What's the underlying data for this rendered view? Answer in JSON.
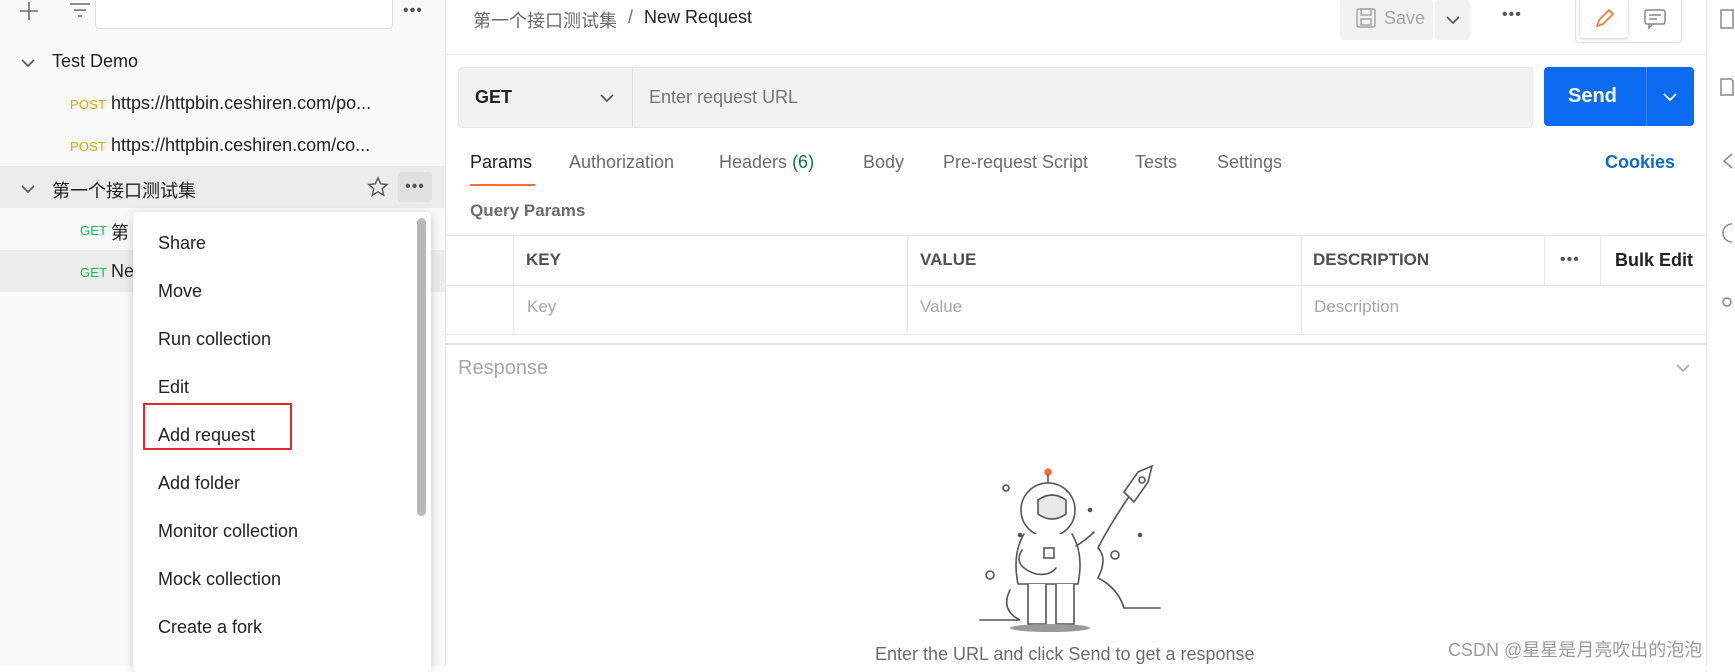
{
  "sidebar": {
    "collections": [
      {
        "name": "Test Demo",
        "requests": [
          {
            "method": "POST",
            "url": "https://httpbin.ceshiren.com/po..."
          },
          {
            "method": "POST",
            "url": "https://httpbin.ceshiren.com/co..."
          }
        ]
      },
      {
        "name": "第一个接口测试集",
        "requests": [
          {
            "method": "GET",
            "name": "第"
          },
          {
            "method": "GET",
            "name": "Ne"
          }
        ]
      }
    ],
    "more_label": "•••"
  },
  "context_menu": {
    "items": [
      "Share",
      "Move",
      "Run collection",
      "Edit",
      "Add request",
      "Add folder",
      "Monitor collection",
      "Mock collection",
      "Create a fork"
    ]
  },
  "header": {
    "breadcrumb_collection": "第一个接口测试集",
    "breadcrumb_sep": "/",
    "request_title": "New Request",
    "save_label": "Save",
    "more_label": "•••"
  },
  "request": {
    "method": "GET",
    "url_placeholder": "Enter request URL",
    "send_label": "Send"
  },
  "tabs": {
    "params": "Params",
    "authorization": "Authorization",
    "headers": "Headers",
    "headers_count": "(6)",
    "body": "Body",
    "prerequest": "Pre-request Script",
    "tests": "Tests",
    "settings": "Settings",
    "cookies": "Cookies"
  },
  "query_params": {
    "title": "Query Params",
    "columns": {
      "key": "KEY",
      "value": "VALUE",
      "description": "DESCRIPTION"
    },
    "more_label": "•••",
    "bulk_edit": "Bulk Edit",
    "placeholders": {
      "key": "Key",
      "value": "Value",
      "description": "Description"
    }
  },
  "response": {
    "title": "Response",
    "empty_message": "Enter the URL and click Send to get a response"
  },
  "watermark": "CSDN @星星是月亮吹出的泡泡",
  "colors": {
    "accent": "#ff6c37",
    "send_blue": "#0a6bf0",
    "link_blue": "#0b6acb",
    "post": "#e0a300",
    "get": "#0cbb52",
    "highlight_red": "#e8262a"
  }
}
